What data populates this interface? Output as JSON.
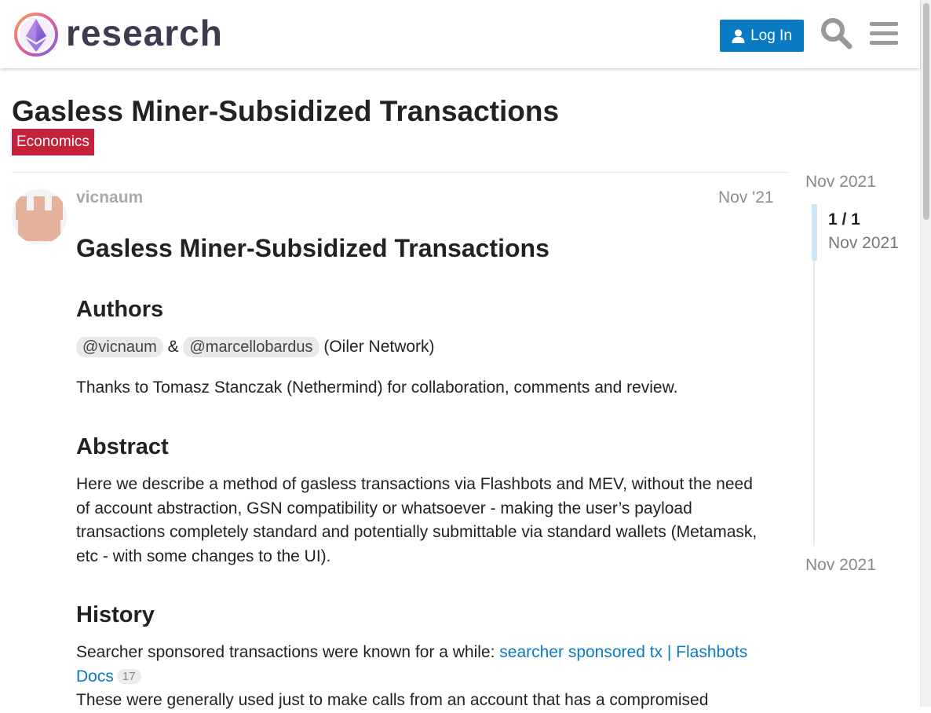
{
  "header": {
    "brand": "research",
    "login_label": "Log In"
  },
  "icons": {
    "logo": "ethereum-research-logo",
    "login": "user-icon",
    "search": "search-icon",
    "menu": "hamburger-menu-icon"
  },
  "colors": {
    "primary": "#0a7ac2",
    "category": "#c4213a",
    "text": "#222222",
    "muted": "#8e8e8e"
  },
  "topic": {
    "title": "Gasless Miner-Subsidized Transactions",
    "category": "Economics"
  },
  "post": {
    "username": "vicnaum",
    "date": "Nov '21",
    "heading": "Gasless Miner-Subsidized Transactions",
    "authors_heading": "Authors",
    "mention_1": "@vicnaum",
    "ampersand": "&",
    "mention_2": "@marcellobardus",
    "org": "(Oiler Network)",
    "thanks": "Thanks to Tomasz Stanczak (Nethermind) for collaboration, comments and review.",
    "abstract_heading": "Abstract",
    "abstract": "Here we describe a method of gasless transactions via Flashbots and MEV, without the need of account abstraction, GSN compatibility or whatsoever - making the user’s payload transactions completely standard and potentially submittable via standard wallets (Metamask, etc - with some changes to the UI).",
    "history_heading": "History",
    "history_intro": "Searcher sponsored transactions were known for a while: ",
    "history_link": "searcher sponsored tx | Flashbots Docs",
    "history_link_clicks": "17",
    "history_cont": "These were generally used just to make calls from an account that has a compromised"
  },
  "timeline": {
    "top_date": "Nov 2021",
    "position": "1 / 1",
    "current_date": "Nov 2021",
    "bottom_date": "Nov 2021"
  }
}
